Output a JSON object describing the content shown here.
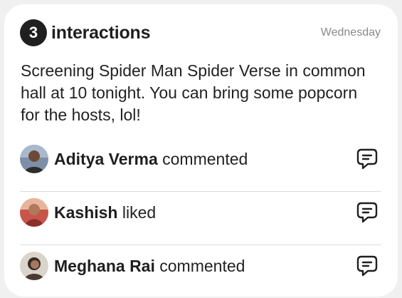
{
  "header": {
    "count": "3",
    "title": "interactions",
    "date": "Wednesday"
  },
  "message": "Screening Spider Man Spider Verse in common hall at 10 tonight. You can bring some popcorn for the hosts, lol!",
  "activities": [
    {
      "name": "Aditya Verma",
      "action": "commented",
      "icon": "message-icon"
    },
    {
      "name": "Kashish",
      "action": "liked",
      "icon": "message-icon"
    },
    {
      "name": "Meghana Rai",
      "action": "commented",
      "icon": "message-icon"
    }
  ],
  "colors": {
    "badge_bg": "#1f1f1f",
    "date_text": "#8a8a8a",
    "divider": "#dcdcdc"
  }
}
